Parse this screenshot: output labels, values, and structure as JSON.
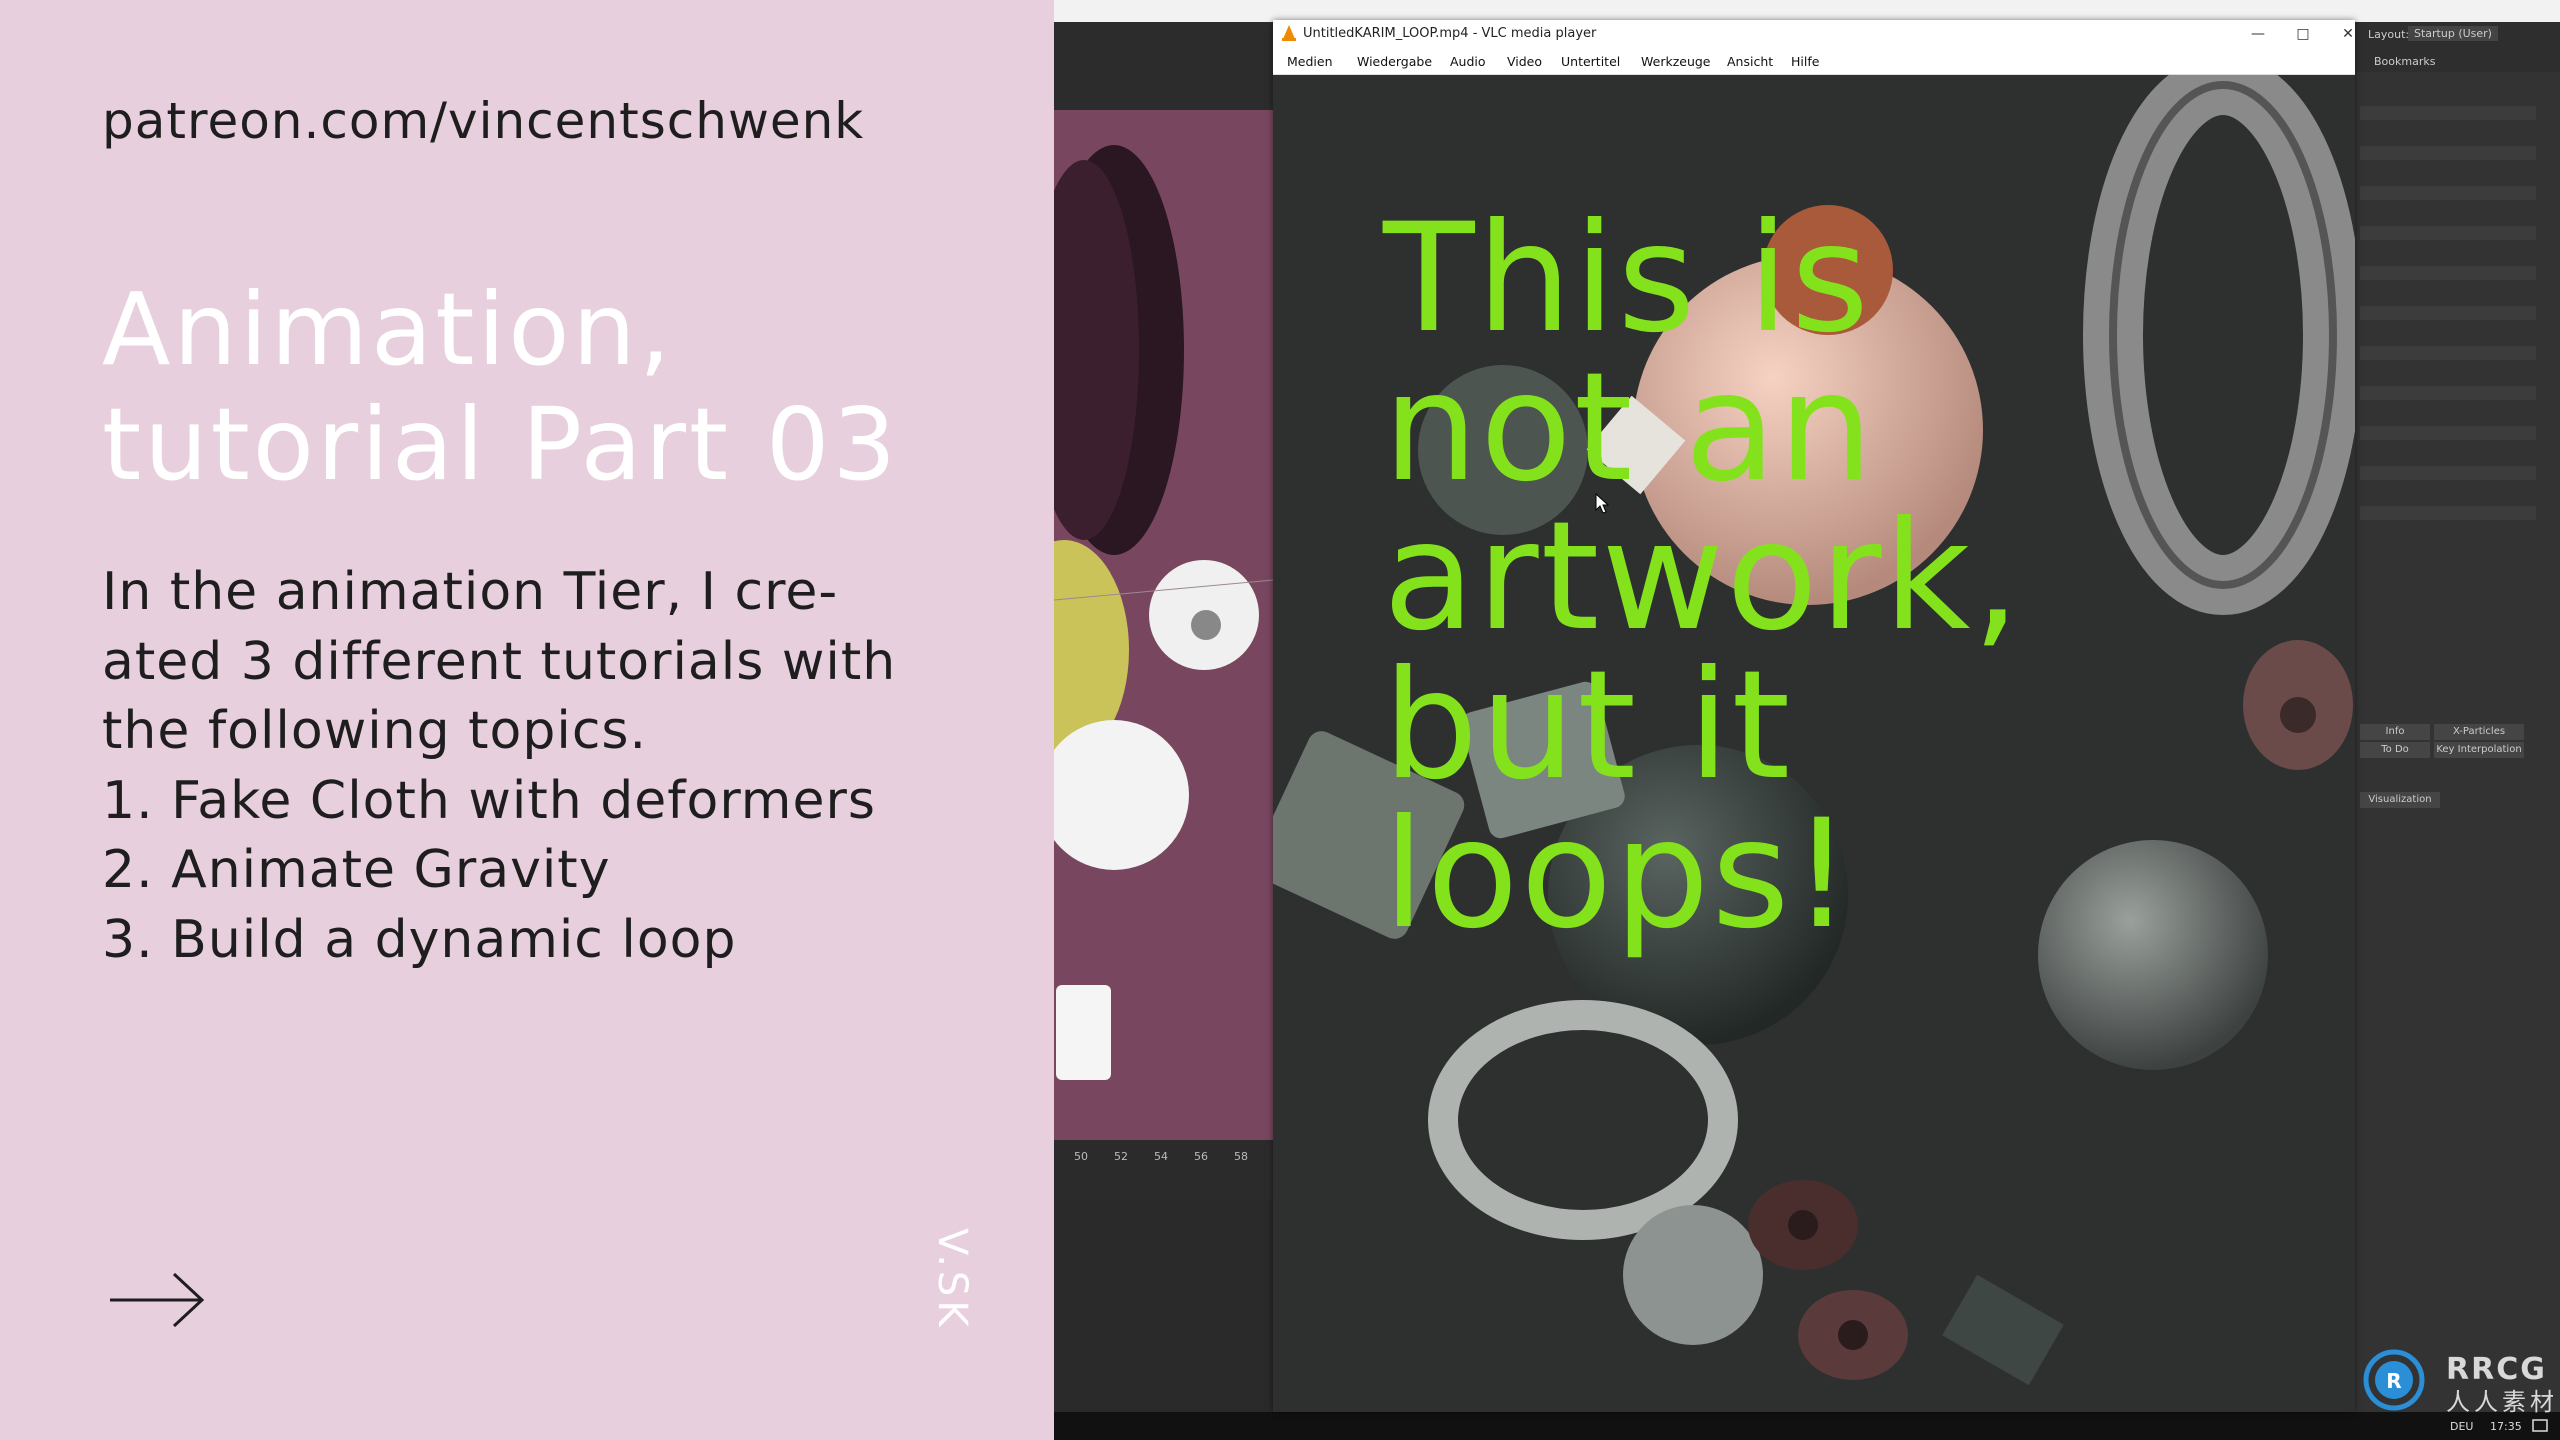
{
  "slide": {
    "url": "patreon.com/vincentschwenk",
    "title_line1": "Animation,",
    "title_line2": "tutorial Part 03",
    "body_lines": [
      "In the animation Tier, I cre-",
      "ated 3 different tutorials with",
      "the following topics.",
      "1. Fake Cloth with deformers",
      "2. Animate Gravity",
      "3. Build a dynamic loop"
    ],
    "brand": "V.SK",
    "arrow_icon": "right-arrow-icon",
    "bg_color": "#e8cfdd",
    "title_color": "#ffffff"
  },
  "vlc": {
    "title": "UntitledKARIM_LOOP.mp4 - VLC media player",
    "menu": [
      "Medien",
      "Wiedergabe",
      "Audio",
      "Video",
      "Untertitel",
      "Werkzeuge",
      "Ansicht",
      "Hilfe"
    ],
    "video_text": [
      "This is",
      "not an",
      "artwork,",
      "but it",
      "loops!"
    ],
    "accent_color": "#84e21c"
  },
  "c4d": {
    "layout_label": "Layout:",
    "layout_value": "Startup (User)",
    "bookmarks": "Bookmarks",
    "timeline_ticks": [
      "50",
      "52",
      "54",
      "56",
      "58"
    ],
    "tabs": [
      "Info",
      "X-Particles",
      "To Do",
      "Key Interpolation"
    ],
    "visualization": "Visualization"
  },
  "watermark": {
    "line1": "RRCG",
    "line2": "人人素材"
  },
  "tray": {
    "lang": "DEU",
    "time": "17:35"
  }
}
